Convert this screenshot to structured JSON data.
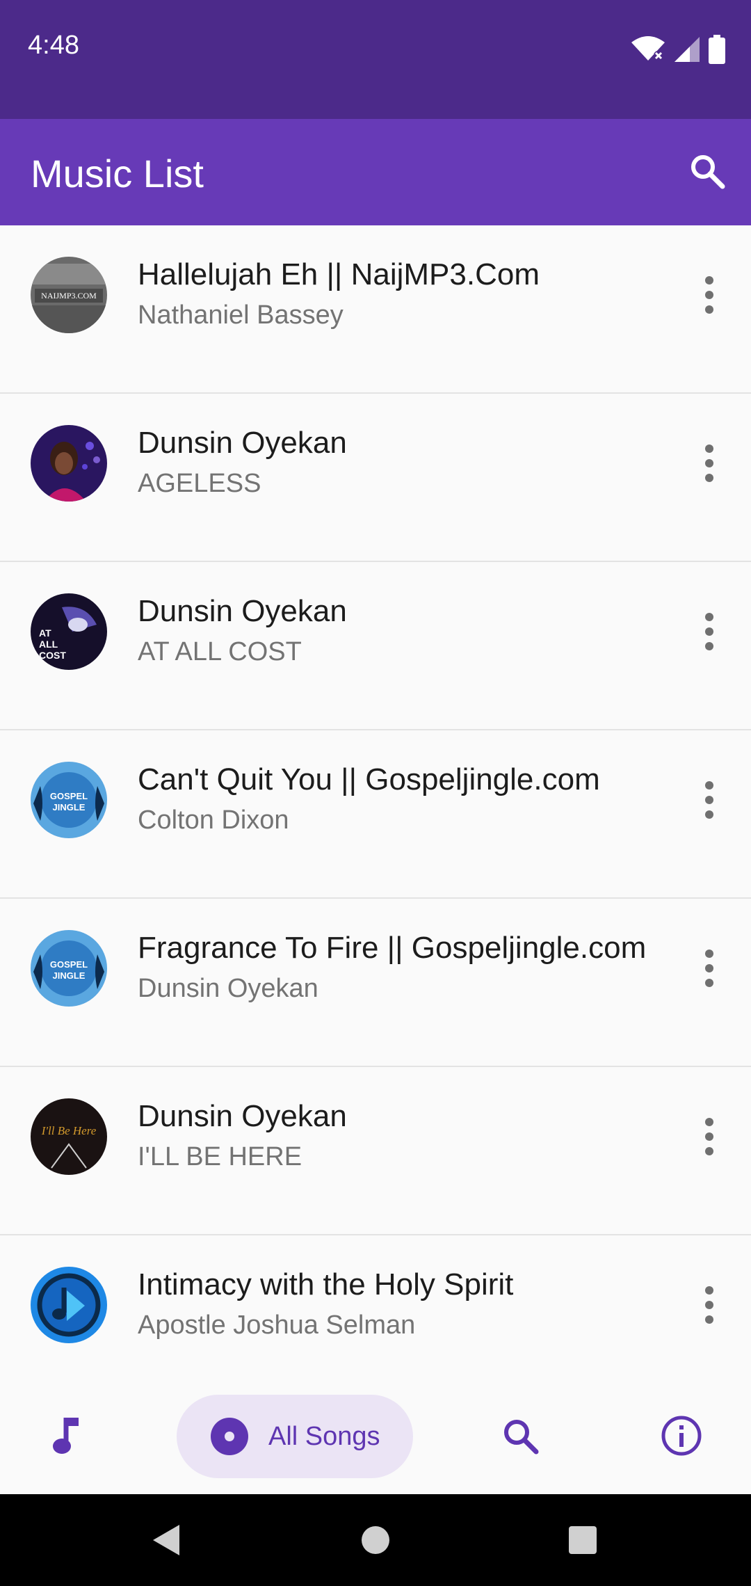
{
  "status_bar": {
    "time": "4:48"
  },
  "app_bar": {
    "title": "Music List"
  },
  "songs": [
    {
      "title": "Hallelujah Eh || NaijMP3.Com",
      "subtitle": "Nathaniel Bassey",
      "art_text": "NAIJMP3.COM"
    },
    {
      "title": "Dunsin Oyekan",
      "subtitle": "AGELESS"
    },
    {
      "title": "Dunsin Oyekan",
      "subtitle": "AT ALL COST",
      "art_text": "AT ALL COST"
    },
    {
      "title": "Can't Quit You || Gospeljingle.com",
      "subtitle": "Colton Dixon",
      "art_text": "GOSPEL JINGLE"
    },
    {
      "title": "Fragrance To Fire || Gospeljingle.com",
      "subtitle": "Dunsin Oyekan",
      "art_text": "GOSPEL JINGLE"
    },
    {
      "title": "Dunsin Oyekan",
      "subtitle": "I'LL BE HERE",
      "art_text": "I'll Be Here"
    },
    {
      "title": "Intimacy with the Holy Spirit",
      "subtitle": "Apostle Joshua Selman"
    }
  ],
  "bottom_nav": {
    "items": [
      {
        "icon": "music-note-icon"
      },
      {
        "icon": "disc-icon",
        "label": "All Songs",
        "selected": true
      },
      {
        "icon": "search-icon"
      },
      {
        "icon": "info-icon"
      }
    ]
  },
  "colors": {
    "status_bar": "#4c2a8a",
    "app_bar": "#673ab7",
    "accent": "#5e35b1",
    "pill": "#ebe4f5"
  }
}
